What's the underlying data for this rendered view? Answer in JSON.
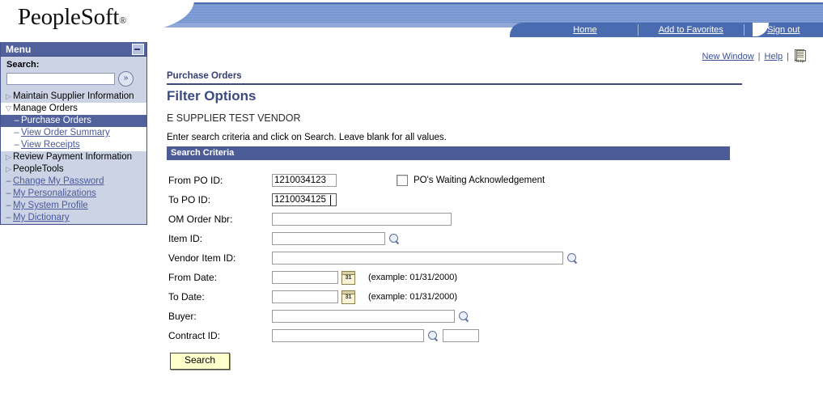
{
  "brand": {
    "logo_text": "PeopleSoft",
    "registered_mark": "®"
  },
  "topnav": {
    "home": "Home",
    "add_to_favorites": "Add to Favorites",
    "sign_out": "Sign out"
  },
  "sidebar": {
    "header_title": "Menu",
    "collapse_icon": "minimize-icon",
    "search_label": "Search:",
    "search_value": "",
    "search_placeholder": "",
    "go_icon": "»",
    "items": [
      {
        "label": "Maintain Supplier Information",
        "bullet": "▷",
        "type": "collapsed-folder"
      },
      {
        "label": "Manage Orders",
        "bullet": "▽",
        "type": "expanded-folder"
      },
      {
        "label": "Purchase Orders",
        "bullet": "–",
        "type": "selected-leaf"
      },
      {
        "label": "View Order Summary",
        "bullet": "–",
        "type": "link-leaf"
      },
      {
        "label": "View Receipts",
        "bullet": "–",
        "type": "link-leaf"
      },
      {
        "label": "Review Payment Information",
        "bullet": "▷",
        "type": "collapsed-folder"
      },
      {
        "label": "PeopleTools",
        "bullet": "▷",
        "type": "collapsed-folder"
      },
      {
        "label": "Change My Password",
        "bullet": "–",
        "type": "link-leaf"
      },
      {
        "label": "My Personalizations",
        "bullet": "–",
        "type": "link-leaf"
      },
      {
        "label": "My System Profile",
        "bullet": "–",
        "type": "link-leaf"
      },
      {
        "label": "My Dictionary",
        "bullet": "–",
        "type": "link-leaf"
      }
    ]
  },
  "page_links": {
    "new_window": "New Window",
    "help": "Help",
    "sep1": "|",
    "sep2": "|",
    "http_icon_caption": "http"
  },
  "main": {
    "breadcrumb": "Purchase Orders",
    "title": "Filter Options",
    "vendor": "E SUPPLIER TEST VENDOR",
    "instructions": "Enter search criteria and click on Search. Leave blank for all values.",
    "criteria_bar": "Search Criteria"
  },
  "form": {
    "from_po_id": {
      "label": "From PO ID:",
      "value": "1210034123"
    },
    "to_po_id": {
      "label": "To PO ID:",
      "value": "1210034125",
      "focused": true
    },
    "om_order_nbr": {
      "label": "OM Order Nbr:",
      "value": ""
    },
    "item_id": {
      "label": "Item ID:",
      "value": ""
    },
    "vendor_item_id": {
      "label": "Vendor Item ID:",
      "value": ""
    },
    "from_date": {
      "label": "From Date:",
      "value": "",
      "hint": "(example: 01/31/2000)"
    },
    "to_date": {
      "label": "To Date:",
      "value": "",
      "hint": "(example: 01/31/2000)"
    },
    "buyer": {
      "label": "Buyer:",
      "value": ""
    },
    "contract_id": {
      "label": "Contract ID:",
      "value": "",
      "secondary_value": ""
    },
    "waiting_ack": {
      "label": "PO's Waiting Acknowledgement",
      "checked": false
    },
    "search_button": "Search",
    "calendar_icon_day": "31"
  },
  "colors": {
    "banner_blue": "#4a6bb0",
    "menu_header": "#51619b",
    "sidebar_bg": "#ccd3e4",
    "criteria_bar": "#4c5c96",
    "title_blue": "#3b4a80",
    "button_yellow": "#ffffcc"
  }
}
